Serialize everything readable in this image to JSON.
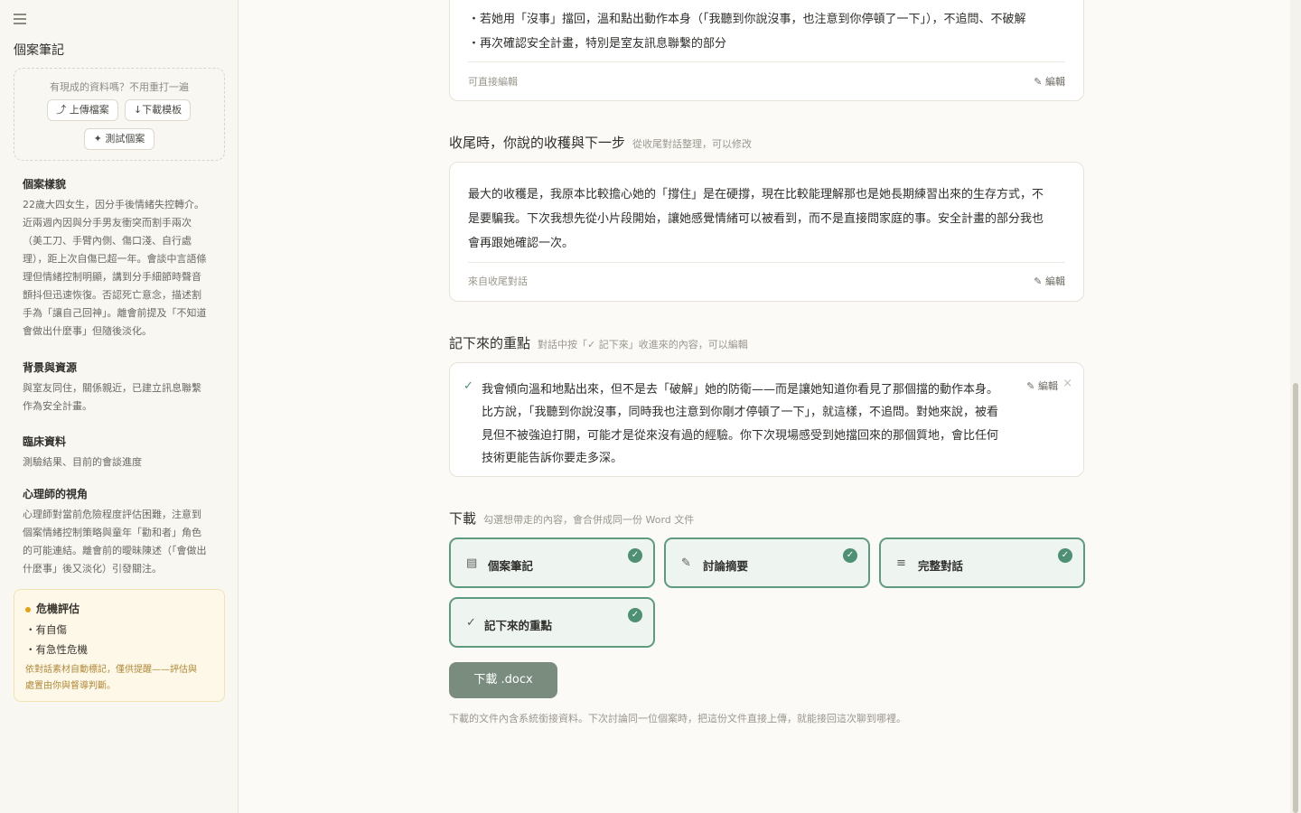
{
  "sidebar": {
    "title": "個案筆記",
    "upload_hint": "有現成的資料嗎？不用重打一遍",
    "upload_button": "⤴ 上傳檔案",
    "template_button": "↓下載模板",
    "test_button": "✦ 測試個案",
    "sections": [
      {
        "heading": "個案樣貌",
        "lines": [
          "22歲大四女生，因分手後情緒失控轉介。",
          "近兩週內因與分手男友衝突而割手兩次",
          "（美工刀、手臂內側、傷口淺、自行處",
          "理），距上次自傷已超一年。會談中言語條",
          "理但情緒控制明顯，講到分手細節時聲音",
          "顫抖但迅速恢復。否認死亡意念，描述割",
          "手為「讓自己回神」。離會前提及「不知道",
          "會做出什麼事」但隨後淡化。"
        ]
      },
      {
        "heading": "背景與資源",
        "lines": [
          "與室友同住，關係親近，已建立訊息聯繫",
          "作為安全計畫。"
        ]
      },
      {
        "heading": "臨床資料",
        "lines": [
          "測驗結果、目前的會談進度"
        ]
      },
      {
        "heading": "心理師的視角",
        "lines": [
          "心理師對當前危險程度評估困難，注意到",
          "個案情緒控制策略與童年「勸和者」角色",
          "的可能連結。離會前的曖昧陳述（「會做出",
          "什麼事」後又淡化）引發關注。"
        ]
      }
    ],
    "risk": {
      "title": "危機評估",
      "items": [
        "・有自傷",
        "・有急性危機"
      ],
      "note_lines": [
        "依對話素材自動標記，僅供提醒——評估與",
        "處置由你與督導判斷。"
      ]
    }
  },
  "main": {
    "top_card": {
      "lines": [
        "・若她用「沒事」擋回，溫和點出動作本身（「我聽到你說沒事，也注意到你停頓了一下」），不追問、不破解",
        "・再次確認安全計畫，特別是室友訊息聯繫的部分"
      ],
      "footer_label": "可直接編輯",
      "edit_label": "✎ 編輯"
    },
    "closing": {
      "title": "收尾時，你說的收穫與下一步",
      "subtitle": "從收尾對話整理，可以修改",
      "lines": [
        "最大的收穫是，我原本比較擔心她的「撐住」是在硬撐，現在比較能理解那也是她長期練習出來的生存方式，不",
        "是要騙我。下次我想先從小片段開始，讓她感覺情緒可以被看到，而不是直接問家庭的事。安全計畫的部分我也",
        "會再跟她確認一次。"
      ],
      "footer_label": "來自收尾對話",
      "edit_label": "✎ 編輯"
    },
    "notes": {
      "title": "記下來的重點",
      "subtitle": "對話中按「✓ 記下來」收進來的內容，可以編輯",
      "check": "✓",
      "lines": [
        "我會傾向溫和地點出來，但不是去「破解」她的防衛——而是讓她知道你看見了那個擋的動作本身。",
        "比方說，「我聽到你說沒事，同時我也注意到你剛才停頓了一下」，就這樣，不追問。對她來說，被看",
        "見但不被強迫打開，可能才是從來沒有過的經驗。你下次現場感受到她擋回來的那個質地，會比任何",
        "技術更能告訴你要走多深。"
      ],
      "edit_label": "✎ 編輯",
      "remove": "×"
    },
    "download": {
      "title": "下載",
      "subtitle": "勾選想帶走的內容，會合併成同一份 Word 文件",
      "options": [
        {
          "icon": "▤",
          "label": "個案筆記",
          "checked": "✓"
        },
        {
          "icon": "✎",
          "label": "討論摘要",
          "checked": "✓"
        },
        {
          "icon": "≡",
          "label": "完整對話",
          "checked": "✓"
        },
        {
          "icon": "✓",
          "label": "記下來的重點",
          "checked": "✓"
        }
      ],
      "button": "下載 .docx",
      "note": "下載的文件內含系統銜接資料。下次討論同一位個案時，把這份文件直接上傳，就能接回這次聊到哪裡。"
    }
  }
}
